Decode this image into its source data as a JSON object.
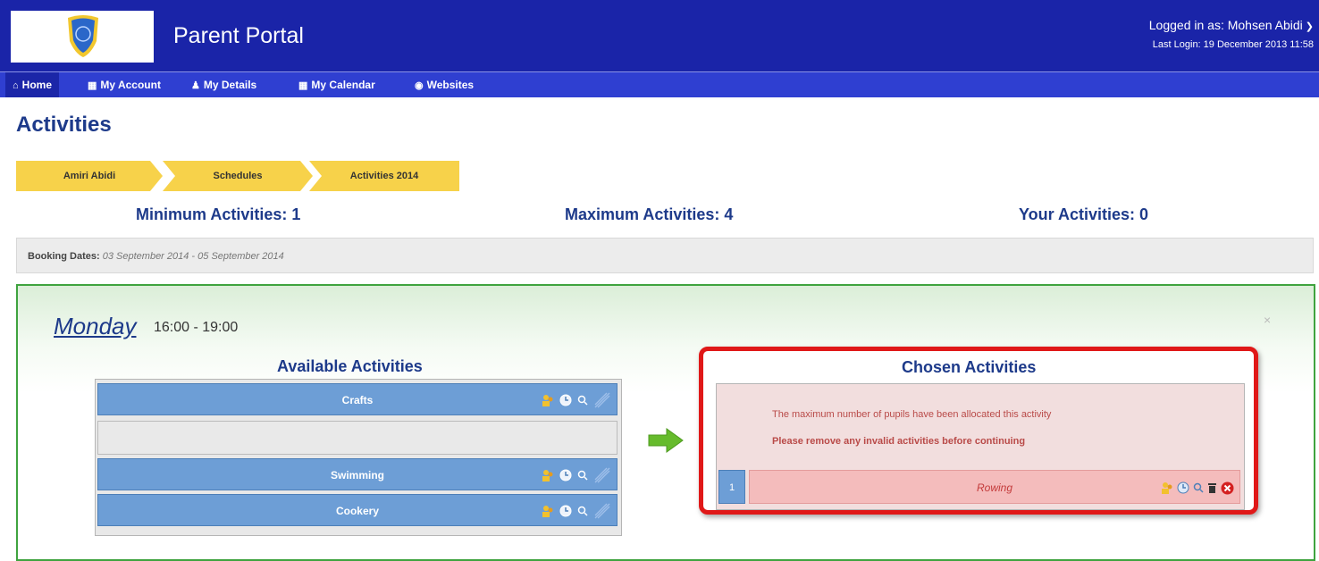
{
  "app": {
    "title": "Parent Portal"
  },
  "user": {
    "logged_in_as": "Logged in as: Mohsen Abidi",
    "last_login": "Last Login: 19 December 2013 11:58"
  },
  "nav": [
    {
      "label": "Home",
      "icon": "home-icon"
    },
    {
      "label": "My Account",
      "icon": "card-icon"
    },
    {
      "label": "My Details",
      "icon": "user-icon"
    },
    {
      "label": "My Calendar",
      "icon": "calendar-icon"
    },
    {
      "label": "Websites",
      "icon": "globe-icon"
    }
  ],
  "page": {
    "title": "Activities"
  },
  "breadcrumb": [
    "Amiri Abidi",
    "Schedules",
    "Activities 2014"
  ],
  "stats": {
    "minimum": "Minimum Activities: 1",
    "maximum": "Maximum Activities: 4",
    "yours": "Your Activities: 0"
  },
  "booking": {
    "label": "Booking Dates:",
    "dates": "03 September 2014 - 05 September 2014"
  },
  "day": {
    "name": "Monday",
    "time": "16:00 - 19:00",
    "close": "×"
  },
  "available": {
    "title": "Available Activities",
    "items": [
      {
        "label": "Crafts"
      },
      {
        "label": ""
      },
      {
        "label": "Swimming"
      },
      {
        "label": "Cookery"
      }
    ]
  },
  "chosen": {
    "title": "Chosen Activities",
    "message_full": "The maximum number of pupils have been allocated this activity",
    "message_remove": "Please remove any invalid activities before continuing",
    "rows": [
      {
        "number": "1",
        "label": "Rowing"
      }
    ]
  },
  "colors": {
    "header": "#1a24a8",
    "nav": "#2f3fd1",
    "crumb": "#f7d24a",
    "row": "#6d9ed6",
    "error": "#e01818"
  }
}
